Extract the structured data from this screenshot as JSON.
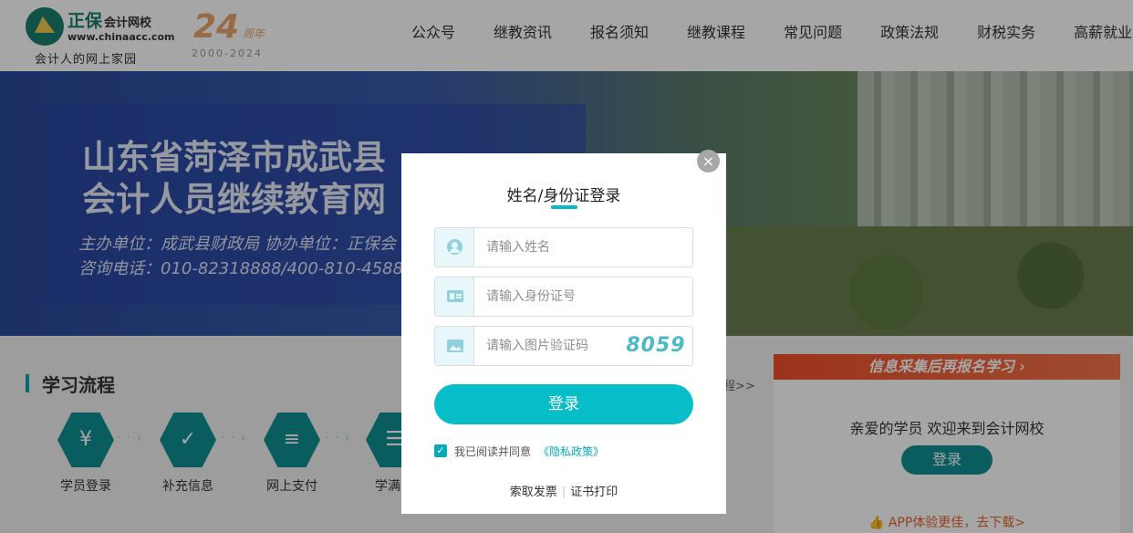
{
  "header": {
    "logo_name": "正保",
    "logo_name_small": "会计网校",
    "logo_url": "www.chinaacc.com",
    "logo_slogan": "会计人的网上家园",
    "anniversary_number": "24",
    "anniversary_label": "周年",
    "anniversary_years": "2000-2024",
    "nav": [
      "公众号",
      "继教资讯",
      "报名须知",
      "继教课程",
      "常见问题",
      "政策法规",
      "财税实务",
      "高薪就业"
    ]
  },
  "banner": {
    "title_line1": "山东省菏泽市成武县",
    "title_line2": "会计人员继续教育网",
    "sub_line1": "主办单位：成武县财政局  协办单位：正保会",
    "sub_line2": "咨询电话：010-82318888/400-810-4588"
  },
  "process": {
    "title": "学习流程",
    "more": "程>>",
    "steps": [
      {
        "label": "学员登录",
        "icon": "money-bag-icon",
        "glyph": "¥"
      },
      {
        "label": "补充信息",
        "icon": "user-check-icon",
        "glyph": "✓"
      },
      {
        "label": "网上支付",
        "icon": "bill-icon",
        "glyph": "≡"
      },
      {
        "label": "学满学",
        "icon": "certificate-icon",
        "glyph": "☰"
      }
    ]
  },
  "side": {
    "banner_text": "信息采集后再报名学习",
    "greeting": "亲爱的学员 欢迎来到会计网校",
    "login_label": "登录",
    "app_text": "APP体验更佳，去下载>"
  },
  "modal": {
    "title": "姓名/身份证登录",
    "close_glyph": "×",
    "name_placeholder": "请输入姓名",
    "id_placeholder": "请输入身份证号",
    "captcha_placeholder": "请输入图片验证码",
    "captcha_code": "8059",
    "login_label": "登录",
    "agree_checked": true,
    "agree_text": "我已阅读并同意",
    "agree_link": "《隐私政策》",
    "invoice_link": "索取发票",
    "separator": "|",
    "certificate_link": "证书打印"
  },
  "colors": {
    "accent": "#07bec8",
    "brand": "#0e8f92",
    "orange": "#f0502a"
  }
}
